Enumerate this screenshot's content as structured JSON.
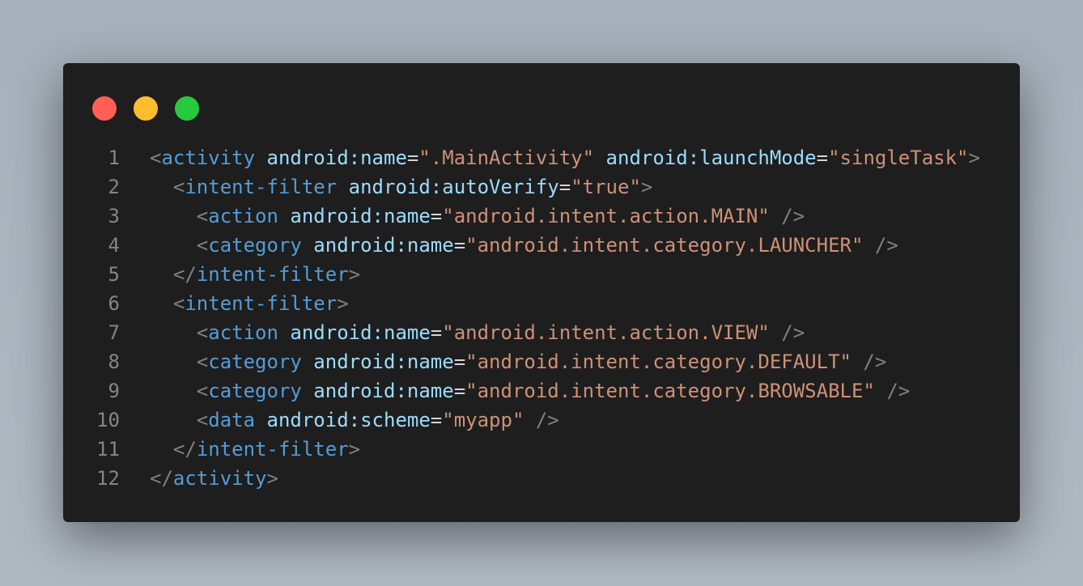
{
  "window_controls": [
    "close",
    "minimize",
    "maximize"
  ],
  "colors": {
    "bracket": "#808080",
    "tag": "#569cd6",
    "attr": "#9cdcfe",
    "string": "#ce9178",
    "background": "#1e1e1e"
  },
  "code_lines": [
    {
      "n": "1",
      "tokens": [
        [
          "bracket",
          "<"
        ],
        [
          "tag",
          "activity"
        ],
        [
          "ws",
          " "
        ],
        [
          "attr",
          "android:name"
        ],
        [
          "eq",
          "="
        ],
        [
          "str",
          "\".MainActivity\""
        ],
        [
          "ws",
          " "
        ],
        [
          "attr",
          "android:launchMode"
        ],
        [
          "eq",
          "="
        ],
        [
          "str",
          "\"singleTask\""
        ],
        [
          "bracket",
          ">"
        ]
      ]
    },
    {
      "n": "2",
      "tokens": [
        [
          "ws",
          "  "
        ],
        [
          "bracket",
          "<"
        ],
        [
          "tag",
          "intent-filter"
        ],
        [
          "ws",
          " "
        ],
        [
          "attr",
          "android:autoVerify"
        ],
        [
          "eq",
          "="
        ],
        [
          "str",
          "\"true\""
        ],
        [
          "bracket",
          ">"
        ]
      ]
    },
    {
      "n": "3",
      "tokens": [
        [
          "ws",
          "    "
        ],
        [
          "bracket",
          "<"
        ],
        [
          "tag",
          "action"
        ],
        [
          "ws",
          " "
        ],
        [
          "attr",
          "android:name"
        ],
        [
          "eq",
          "="
        ],
        [
          "str",
          "\"android.intent.action.MAIN\""
        ],
        [
          "ws",
          " "
        ],
        [
          "bracket",
          "/>"
        ]
      ]
    },
    {
      "n": "4",
      "tokens": [
        [
          "ws",
          "    "
        ],
        [
          "bracket",
          "<"
        ],
        [
          "tag",
          "category"
        ],
        [
          "ws",
          " "
        ],
        [
          "attr",
          "android:name"
        ],
        [
          "eq",
          "="
        ],
        [
          "str",
          "\"android.intent.category.LAUNCHER\""
        ],
        [
          "ws",
          " "
        ],
        [
          "bracket",
          "/>"
        ]
      ]
    },
    {
      "n": "5",
      "tokens": [
        [
          "ws",
          "  "
        ],
        [
          "bracket",
          "</"
        ],
        [
          "tag",
          "intent-filter"
        ],
        [
          "bracket",
          ">"
        ]
      ]
    },
    {
      "n": "6",
      "tokens": [
        [
          "ws",
          "  "
        ],
        [
          "bracket",
          "<"
        ],
        [
          "tag",
          "intent-filter"
        ],
        [
          "bracket",
          ">"
        ]
      ]
    },
    {
      "n": "7",
      "tokens": [
        [
          "ws",
          "    "
        ],
        [
          "bracket",
          "<"
        ],
        [
          "tag",
          "action"
        ],
        [
          "ws",
          " "
        ],
        [
          "attr",
          "android:name"
        ],
        [
          "eq",
          "="
        ],
        [
          "str",
          "\"android.intent.action.VIEW\""
        ],
        [
          "ws",
          " "
        ],
        [
          "bracket",
          "/>"
        ]
      ]
    },
    {
      "n": "8",
      "tokens": [
        [
          "ws",
          "    "
        ],
        [
          "bracket",
          "<"
        ],
        [
          "tag",
          "category"
        ],
        [
          "ws",
          " "
        ],
        [
          "attr",
          "android:name"
        ],
        [
          "eq",
          "="
        ],
        [
          "str",
          "\"android.intent.category.DEFAULT\""
        ],
        [
          "ws",
          " "
        ],
        [
          "bracket",
          "/>"
        ]
      ]
    },
    {
      "n": "9",
      "tokens": [
        [
          "ws",
          "    "
        ],
        [
          "bracket",
          "<"
        ],
        [
          "tag",
          "category"
        ],
        [
          "ws",
          " "
        ],
        [
          "attr",
          "android:name"
        ],
        [
          "eq",
          "="
        ],
        [
          "str",
          "\"android.intent.category.BROWSABLE\""
        ],
        [
          "ws",
          " "
        ],
        [
          "bracket",
          "/>"
        ]
      ]
    },
    {
      "n": "10",
      "tokens": [
        [
          "ws",
          "    "
        ],
        [
          "bracket",
          "<"
        ],
        [
          "tag",
          "data"
        ],
        [
          "ws",
          " "
        ],
        [
          "attr",
          "android:scheme"
        ],
        [
          "eq",
          "="
        ],
        [
          "str",
          "\"myapp\""
        ],
        [
          "ws",
          " "
        ],
        [
          "bracket",
          "/>"
        ]
      ]
    },
    {
      "n": "11",
      "tokens": [
        [
          "ws",
          "  "
        ],
        [
          "bracket",
          "</"
        ],
        [
          "tag",
          "intent-filter"
        ],
        [
          "bracket",
          ">"
        ]
      ]
    },
    {
      "n": "12",
      "tokens": [
        [
          "bracket",
          "</"
        ],
        [
          "tag",
          "activity"
        ],
        [
          "bracket",
          ">"
        ]
      ]
    }
  ]
}
